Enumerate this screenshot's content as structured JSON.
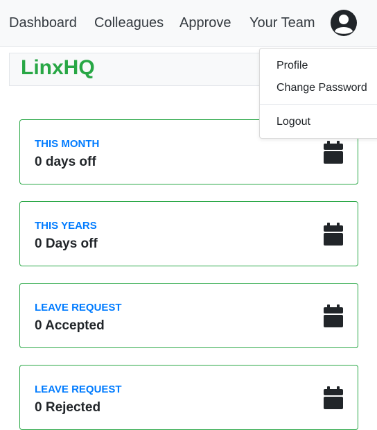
{
  "navbar": {
    "links": [
      "Dashboard",
      "Colleagues",
      "Approve",
      "Your Team"
    ]
  },
  "brand": "LinxHQ",
  "user_menu": {
    "items": [
      "Profile",
      "Change Password",
      "Logout"
    ]
  },
  "cards": [
    {
      "label": "THIS MONTH",
      "value": "0 days off",
      "icon": "calendar-icon"
    },
    {
      "label": "THIS YEARS",
      "value": "0 Days off",
      "icon": "calendar-icon"
    },
    {
      "label": "LEAVE REQUEST",
      "value": "0 Accepted",
      "icon": "calendar-icon"
    },
    {
      "label": "LEAVE REQUEST",
      "value": "0 Rejected",
      "icon": "calendar-icon"
    }
  ],
  "colors": {
    "brand": "#28a745",
    "card_border": "#28a745",
    "card_label": "#007bff",
    "icon": "#212529"
  }
}
